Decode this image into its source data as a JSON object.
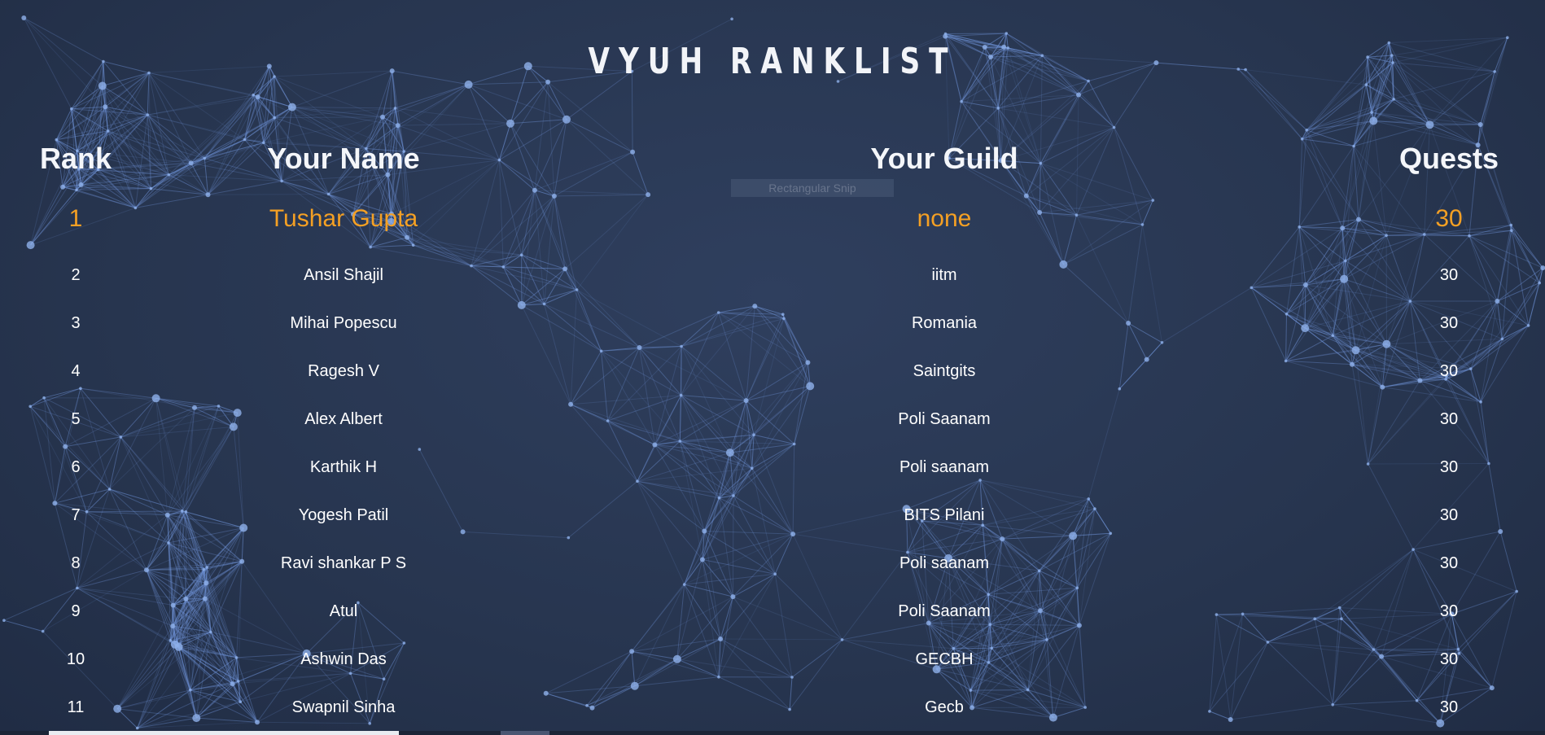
{
  "title": "VYUH RANKLIST",
  "headers": {
    "rank": "Rank",
    "name": "Your Name",
    "guild": "Your Guild",
    "quests": "Quests"
  },
  "snip_label": "Rectangular Snip",
  "colors": {
    "background": "#2b3a55",
    "highlight": "#f4a024",
    "network": "#6f93d8"
  },
  "rows": [
    {
      "rank": "1",
      "name": "Tushar Gupta",
      "guild": "none",
      "quests": "30"
    },
    {
      "rank": "2",
      "name": "Ansil Shajil",
      "guild": "iitm",
      "quests": "30"
    },
    {
      "rank": "3",
      "name": "Mihai Popescu",
      "guild": "Romania",
      "quests": "30"
    },
    {
      "rank": "4",
      "name": "Ragesh V",
      "guild": "Saintgits",
      "quests": "30"
    },
    {
      "rank": "5",
      "name": "Alex Albert",
      "guild": "Poli Saanam",
      "quests": "30"
    },
    {
      "rank": "6",
      "name": "Karthik H",
      "guild": "Poli saanam",
      "quests": "30"
    },
    {
      "rank": "7",
      "name": "Yogesh Patil",
      "guild": "BITS Pilani",
      "quests": "30"
    },
    {
      "rank": "8",
      "name": "Ravi shankar P S",
      "guild": "Poli saanam",
      "quests": "30"
    },
    {
      "rank": "9",
      "name": "Atul",
      "guild": "Poli Saanam",
      "quests": "30"
    },
    {
      "rank": "10",
      "name": "Ashwin Das",
      "guild": "GECBH",
      "quests": "30"
    },
    {
      "rank": "11",
      "name": "Swapnil Sinha",
      "guild": "Gecb",
      "quests": "30"
    }
  ]
}
